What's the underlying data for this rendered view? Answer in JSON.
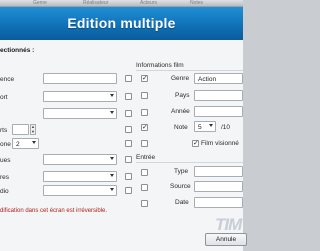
{
  "top_strip": {
    "items": [
      "Genre",
      "Réalisateur",
      "Acteurs",
      "Notes"
    ]
  },
  "title": "Edition multiple",
  "left": {
    "heading": "ectionnés :",
    "labels": [
      "ence",
      "ort",
      "",
      "rts",
      "one",
      "ues",
      "res",
      "dio"
    ],
    "note_select": "2"
  },
  "right": {
    "section_film": "Informations film",
    "genre_label": "Genre",
    "genre_value": "Action",
    "pays_label": "Pays",
    "annee_label": "Année",
    "note_label": "Note",
    "note_value": "5",
    "note_max": "/10",
    "film_vu_label": "Film visionné",
    "section_entree": "Entrée",
    "type_label": "Type",
    "source_label": "Source",
    "date_label": "Date"
  },
  "warning": "dification dans cet écran est irréversible.",
  "cancel_label": "Annule",
  "watermark": "TIM",
  "colors": {
    "title_bar": "#0f6fb4",
    "warning": "#b0201a"
  }
}
